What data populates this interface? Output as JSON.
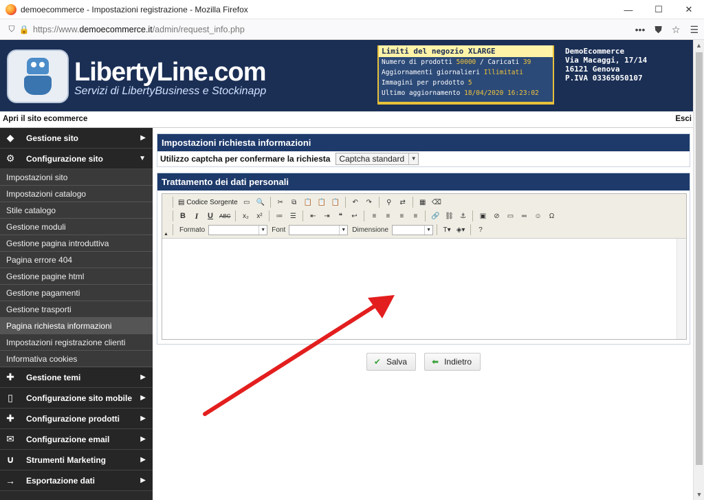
{
  "browser": {
    "window_title": "demoecommerce - Impostazioni registrazione - Mozilla Firefox",
    "url_prefix": "https://www.",
    "url_domain": "demoecommerce.it",
    "url_path": "/admin/request_info.php"
  },
  "header": {
    "brand": "LibertyLine.com",
    "brand_sub": "Servizi di LibertyBusiness e Stockinapp",
    "limits": {
      "title": "Limiti del negozio XLARGE",
      "rows": [
        {
          "label": "Numero di prodotti ",
          "value": "50000",
          "label2": " / Caricati ",
          "value2": "39"
        },
        {
          "label": "Aggiornamenti giornalieri ",
          "value": "Illimitati"
        },
        {
          "label": "Immagini per prodotto ",
          "value": "5"
        },
        {
          "label": "Ultimo aggiornamento ",
          "value": "18/04/2020 16:23:02"
        }
      ]
    },
    "company": {
      "name": "DemoEcommerce",
      "street": "Via Macaggi, 17/14",
      "city": "16121 Genova",
      "vat": "P.IVA 03365050107"
    }
  },
  "topnav": {
    "open_site": "Apri il sito ecommerce",
    "exit": "Esci"
  },
  "sidebar": {
    "main_top": [
      {
        "label": "Gestione sito",
        "icon": "diamond-icon",
        "arrow": "▶"
      },
      {
        "label": "Configurazione sito",
        "icon": "gear-icon",
        "arrow": "▼"
      }
    ],
    "sub_items": [
      "Impostazioni sito",
      "Impostazioni catalogo",
      "Stile catalogo",
      "Gestione moduli",
      "Gestione pagina introduttiva",
      "Pagina errore 404",
      "Gestione pagine html",
      "Gestione pagamenti",
      "Gestione trasporti",
      "Pagina richiesta informazioni",
      "Impostazioni registrazione clienti",
      "Informativa cookies"
    ],
    "active_index": 9,
    "main_bottom": [
      {
        "label": "Gestione temi",
        "icon": "puzzle-icon"
      },
      {
        "label": "Configurazione sito mobile",
        "icon": "mobile-icon"
      },
      {
        "label": "Configurazione prodotti",
        "icon": "puzzle-icon"
      },
      {
        "label": "Configurazione email",
        "icon": "envelope-icon"
      },
      {
        "label": "Strumenti Marketing",
        "icon": "magnet-icon"
      },
      {
        "label": "Esportazione dati",
        "icon": "arrow-right-icon"
      }
    ]
  },
  "main": {
    "section1_title": "Impostazioni richiesta informazioni",
    "captcha_label": "Utilizzo captcha per confermare la richiesta",
    "captcha_value": "Captcha standard",
    "section2_title": "Trattamento dei dati personali",
    "toolbar": {
      "source": "Codice Sorgente",
      "format_label": "Formato",
      "font_label": "Font",
      "size_label": "Dimensione"
    },
    "save_button": "Salva",
    "back_button": "Indietro"
  },
  "colors": {
    "header_bg": "#1b2f55",
    "section_header_bg": "#1e3a6b",
    "sidebar_bg": "#2a2a2a",
    "annotation_arrow": "#e31e1e"
  }
}
